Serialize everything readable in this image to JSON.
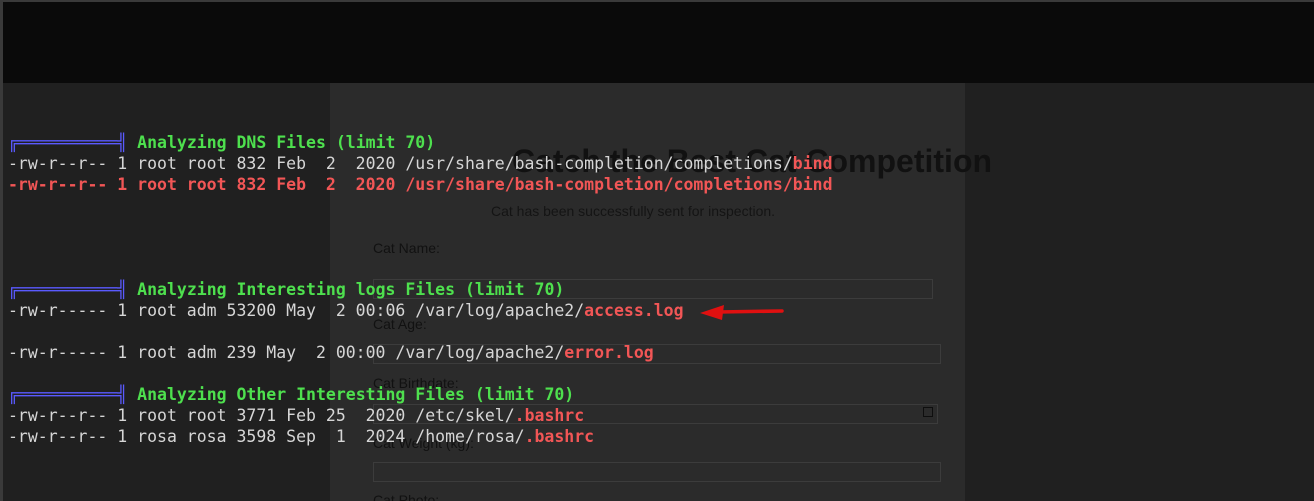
{
  "background_page": {
    "title": "Catch the Best Cat Competition",
    "subtitle": "Cat has been successfully sent for inspection.",
    "labels": {
      "name": "Cat Name:",
      "age": "Cat Age:",
      "birth": "Cat Birthdate:",
      "weight": "Cat Weight (kg):",
      "photo": "Cat Photo:"
    }
  },
  "terminal": {
    "bar_glyph": "╔══════════╣",
    "sections": [
      {
        "header": "Analyzing DNS Files (limit 70)",
        "rows": [
          {
            "prefix": "-rw-r--r-- 1 root root 832 Feb  2  2020 /usr/share/bash-completion/completions/",
            "hl": "bind"
          },
          {
            "prefix": "-rw-r--r-- 1 root root 832 Feb  2  2020 /usr/share/bash-completion/completions/",
            "hl": "bind"
          }
        ]
      },
      {
        "header": "Analyzing Interesting logs Files (limit 70)",
        "rows": [
          {
            "prefix": "-rw-r----- 1 root adm 53200 May  2 00:06 /var/log/apache2/",
            "hl": "access.log"
          },
          {
            "prefix": "-rw-r----- 1 root adm 239 May  2 00:00 /var/log/apache2/",
            "hl": "error.log"
          }
        ]
      },
      {
        "header": "Analyzing Other Interesting Files (limit 70)",
        "rows": [
          {
            "prefix": "-rw-r--r-- 1 root root 3771 Feb 25  2020 /etc/skel/",
            "hl": ".bashrc"
          },
          {
            "prefix": "-rw-r--r-- 1 rosa rosa 3598 Sep  1  2024 /home/rosa/",
            "hl": ".bashrc"
          }
        ]
      }
    ]
  },
  "annotation": {
    "arrow_color": "#e01010",
    "icon": "red-arrow-left-icon"
  },
  "colors": {
    "header_green": "#4ee04e",
    "highlight_red": "#f25656",
    "bar_blue": "#5a5aff",
    "text": "#d6d6d6"
  }
}
